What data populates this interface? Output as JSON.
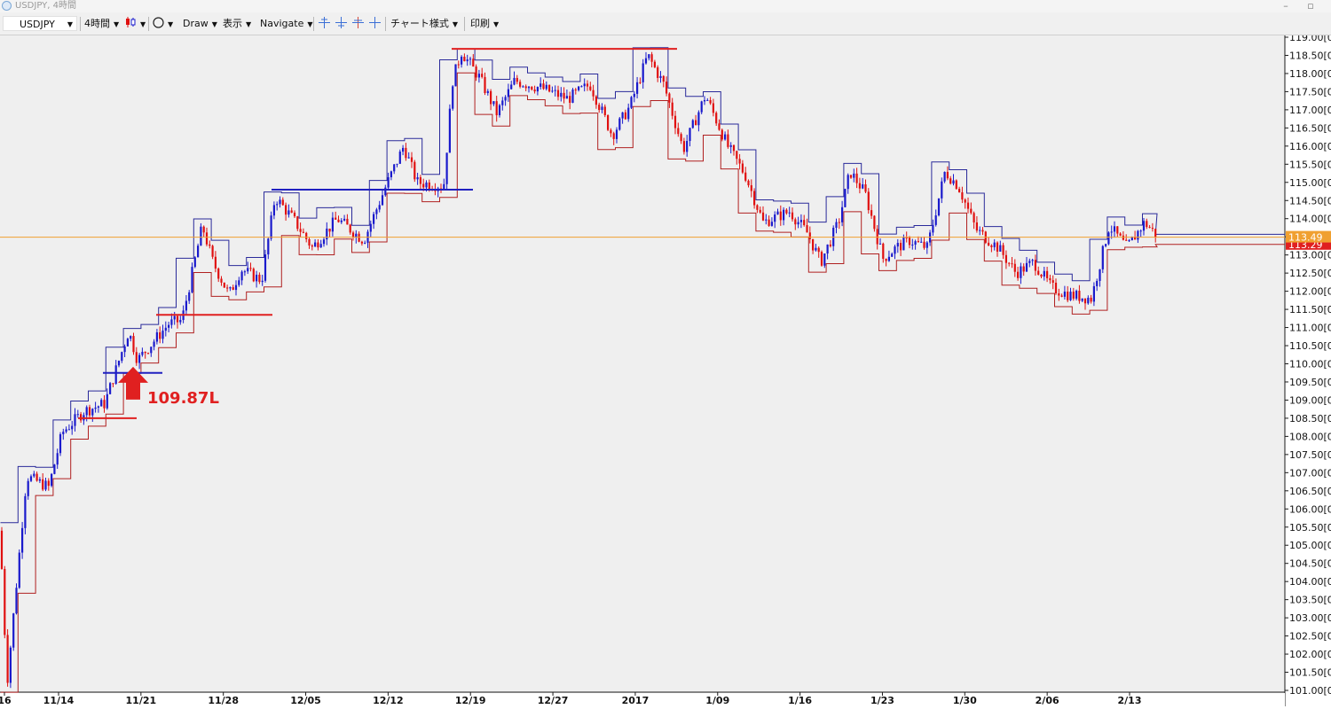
{
  "window": {
    "title": "USDJPY, 4時間"
  },
  "toolbar": {
    "symbol": "USDJPY",
    "timeframe": "4時間",
    "draw": "Draw",
    "display": "表示",
    "navigate": "Navigate",
    "chart_style": "チャート様式",
    "print": "印刷"
  },
  "chart_data": {
    "type": "candlestick",
    "symbol": "USDJPY",
    "timeframe": "4時間",
    "ylim": [
      101.0,
      119.0
    ],
    "y_ticks": [
      "119.00",
      "118.50",
      "118.00",
      "117.50",
      "117.00",
      "116.50",
      "116.00",
      "115.50",
      "115.00",
      "114.50",
      "114.00",
      "113.50",
      "113.00",
      "112.50",
      "112.00",
      "111.50",
      "111.00",
      "110.50",
      "110.00",
      "109.50",
      "109.00",
      "108.50",
      "108.00",
      "107.50",
      "107.00",
      "106.50",
      "106.00",
      "105.50",
      "105.00",
      "104.50",
      "104.00",
      "103.50",
      "103.00",
      "102.50",
      "102.00",
      "101.50",
      "101.00"
    ],
    "y_tick_suffix": "[0",
    "x_ticks": [
      "16",
      "11/14",
      "11/21",
      "11/28",
      "12/05",
      "12/12",
      "12/19",
      "12/27",
      "2017",
      "1/09",
      "1/16",
      "1/23",
      "1/30",
      "2/06",
      "2/13"
    ],
    "current_price": {
      "label": "113.49",
      "value": 113.49,
      "color": "#f0a030"
    },
    "channel_low_marker": {
      "label": "113.29",
      "value": 113.29,
      "color": "#e02020"
    },
    "price_line": 113.49,
    "annotation": {
      "text": "109.87L",
      "value": 109.87,
      "color": "#e02020"
    },
    "horizontal_lines": [
      {
        "value": 108.5,
        "color": "#e02020"
      },
      {
        "value": 109.75,
        "color": "#2020c0"
      },
      {
        "value": 111.35,
        "color": "#e02020"
      },
      {
        "value": 114.8,
        "color": "#2020c0"
      },
      {
        "value": 118.68,
        "color": "#e02020"
      }
    ],
    "up_color": "#1a1acc",
    "down_color": "#e01010",
    "upper_channel_color": "#2a2a9a",
    "lower_channel_color": "#b02020",
    "price_path": [
      [
        0,
        105.4
      ],
      [
        8,
        101.2
      ],
      [
        30,
        106.9
      ],
      [
        55,
        106.6
      ],
      [
        70,
        108.1
      ],
      [
        95,
        108.7
      ],
      [
        118,
        108.9
      ],
      [
        145,
        110.9
      ],
      [
        155,
        110.1
      ],
      [
        190,
        111.1
      ],
      [
        205,
        111.2
      ],
      [
        228,
        113.8
      ],
      [
        240,
        112.8
      ],
      [
        258,
        111.9
      ],
      [
        272,
        112.6
      ],
      [
        295,
        112.3
      ],
      [
        310,
        114.6
      ],
      [
        330,
        114.0
      ],
      [
        352,
        113.2
      ],
      [
        380,
        114.0
      ],
      [
        410,
        113.4
      ],
      [
        435,
        114.9
      ],
      [
        455,
        116.0
      ],
      [
        470,
        115.0
      ],
      [
        500,
        114.9
      ],
      [
        510,
        117.8
      ],
      [
        520,
        118.6
      ],
      [
        540,
        117.9
      ],
      [
        560,
        116.9
      ],
      [
        580,
        117.8
      ],
      [
        610,
        117.6
      ],
      [
        640,
        117.3
      ],
      [
        665,
        117.7
      ],
      [
        690,
        116.3
      ],
      [
        710,
        117.1
      ],
      [
        730,
        118.5
      ],
      [
        748,
        117.7
      ],
      [
        770,
        115.9
      ],
      [
        795,
        117.4
      ],
      [
        820,
        116.0
      ],
      [
        840,
        115.2
      ],
      [
        860,
        113.9
      ],
      [
        890,
        114.2
      ],
      [
        910,
        113.6
      ],
      [
        925,
        112.8
      ],
      [
        945,
        113.9
      ],
      [
        958,
        115.3
      ],
      [
        975,
        114.7
      ],
      [
        995,
        112.9
      ],
      [
        1010,
        113.2
      ],
      [
        1025,
        113.4
      ],
      [
        1045,
        113.2
      ],
      [
        1065,
        115.3
      ],
      [
        1080,
        114.9
      ],
      [
        1100,
        113.7
      ],
      [
        1125,
        113.2
      ],
      [
        1145,
        112.5
      ],
      [
        1165,
        112.8
      ],
      [
        1185,
        112.1
      ],
      [
        1205,
        111.9
      ],
      [
        1230,
        111.8
      ],
      [
        1250,
        113.8
      ],
      [
        1270,
        113.2
      ],
      [
        1290,
        113.9
      ],
      [
        1305,
        113.5
      ]
    ]
  }
}
